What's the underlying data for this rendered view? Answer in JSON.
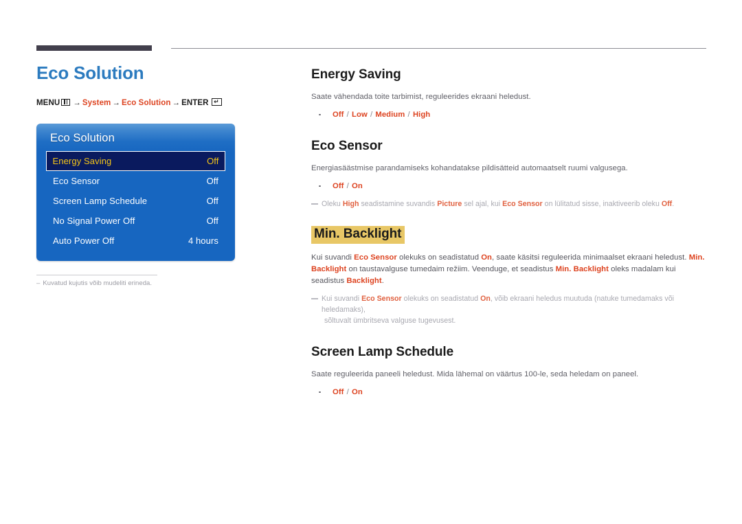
{
  "header": {
    "rule_thick": true,
    "rule_thin": true
  },
  "left": {
    "page_title": "Eco Solution",
    "breadcrumb": {
      "menu_label": "MENU",
      "menu_icon": "menu-grid-icon",
      "arrow": "→",
      "step1": "System",
      "step2": "Eco Solution",
      "enter_label": "ENTER",
      "enter_icon": "enter-key-icon",
      "enter_glyph": "↵"
    },
    "osd": {
      "title": "Eco Solution",
      "rows": [
        {
          "label": "Energy Saving",
          "value": "Off",
          "selected": true
        },
        {
          "label": "Eco Sensor",
          "value": "Off",
          "selected": false
        },
        {
          "label": "Screen Lamp Schedule",
          "value": "Off",
          "selected": false
        },
        {
          "label": "No Signal Power Off",
          "value": "Off",
          "selected": false
        },
        {
          "label": "Auto Power Off",
          "value": "4 hours",
          "selected": false
        }
      ]
    },
    "footnote": {
      "dash": "–",
      "text": "Kuvatud kujutis võib mudeliti erineda."
    }
  },
  "right": {
    "sections": [
      {
        "id": "energy-saving",
        "title": "Energy Saving",
        "highlighted": false,
        "body": "Saate vähendada toite tarbimist, reguleerides ekraani heledust.",
        "options": [
          "Off",
          "Low",
          "Medium",
          "High"
        ],
        "notes": []
      },
      {
        "id": "eco-sensor",
        "title": "Eco Sensor",
        "highlighted": false,
        "body": "Energiasäästmise parandamiseks kohandatakse pildisätteid automaatselt ruumi valgusega.",
        "options": [
          "Off",
          "On"
        ],
        "notes": [
          "Oleku High seadistamine suvandis Picture sel ajal, kui Eco Sensor on lülitatud sisse, inaktiveerib oleku Off."
        ]
      },
      {
        "id": "min-backlight",
        "title": "Min. Backlight",
        "highlighted": true,
        "body": "Kui suvandi Eco Sensor olekuks on seadistatud On, saate käsitsi reguleerida minimaalset ekraani heledust. Min. Backlight on taustavalguse tumedaim režiim. Veenduge, et seadistus Min. Backlight oleks madalam kui seadistus Backlight.",
        "options": [],
        "notes": [
          "Kui suvandi Eco Sensor olekuks on seadistatud On, võib ekraani heledus muutuda (natuke tumedamaks või heledamaks), sõltuvalt ümbritseva valguse tugevusest."
        ]
      },
      {
        "id": "screen-lamp-schedule",
        "title": "Screen Lamp Schedule",
        "highlighted": false,
        "body": "Saate reguleerida paneeli heledust. Mida lähemal on väärtus 100-le, seda heledam on paneel.",
        "options": [
          "Off",
          "On"
        ],
        "notes": []
      }
    ],
    "keywords": [
      "Eco Sensor",
      "Min. Backlight",
      "Backlight",
      "Picture",
      "High",
      "On",
      "Off"
    ],
    "colors": {
      "accent_orange": "#DD4320",
      "title_blue": "#2C7BBF",
      "highlight_yellow": "#E8C766",
      "osd_blue": "#1766C0",
      "osd_selected_navy": "#0A1A5E",
      "osd_selected_text": "#F5C518",
      "rule_dark": "#423F4C"
    }
  }
}
